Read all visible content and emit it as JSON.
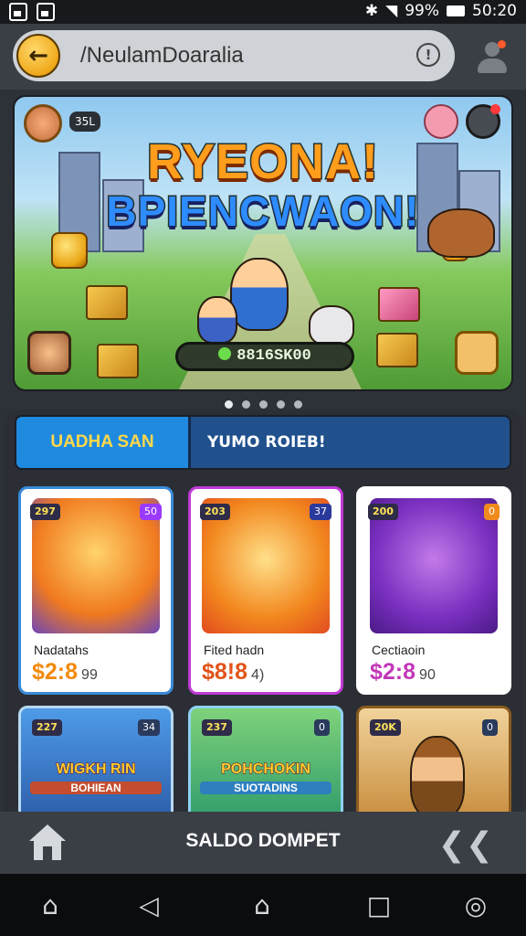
{
  "status_bar": {
    "battery": "99%",
    "time": "50:20"
  },
  "app_bar": {
    "title": "/NeulamDoaralia"
  },
  "banner": {
    "headline_1": "RYEONA!",
    "headline_2": "BPIENCWAON!",
    "counter": "8816SK00",
    "level_tag": "35L"
  },
  "carousel": {
    "count": 5,
    "active": 0
  },
  "segment": {
    "left_label": "UADHA SAN",
    "right_label": "YUMO ROIEB!"
  },
  "products": [
    {
      "tag": "297",
      "tag2": "50",
      "name": "Nadatahs",
      "price": "$2:8",
      "cents": "99",
      "price_color": "#f28a0c"
    },
    {
      "tag": "203",
      "tag2": "37",
      "name": "Fited hadn",
      "price": "$8!8",
      "cents": "4)",
      "price_color": "#e2541a"
    },
    {
      "tag": "200",
      "tag2": "0",
      "name": "Cectiaoin",
      "price": "$2:8",
      "cents": "90",
      "price_color": "#c237b8"
    }
  ],
  "products_row2": [
    {
      "tag": "227",
      "tag2": "34",
      "word": "WIGKH RIN",
      "word2": "BOHIEAN"
    },
    {
      "tag": "237",
      "tag2": "0",
      "word": "POHCHOKIN",
      "word2": "SUOTADINS"
    },
    {
      "tag": "20K",
      "tag2": "0",
      "word": "",
      "word2": ""
    }
  ],
  "bottom_bar": {
    "label": "SALDO DOMPET"
  }
}
